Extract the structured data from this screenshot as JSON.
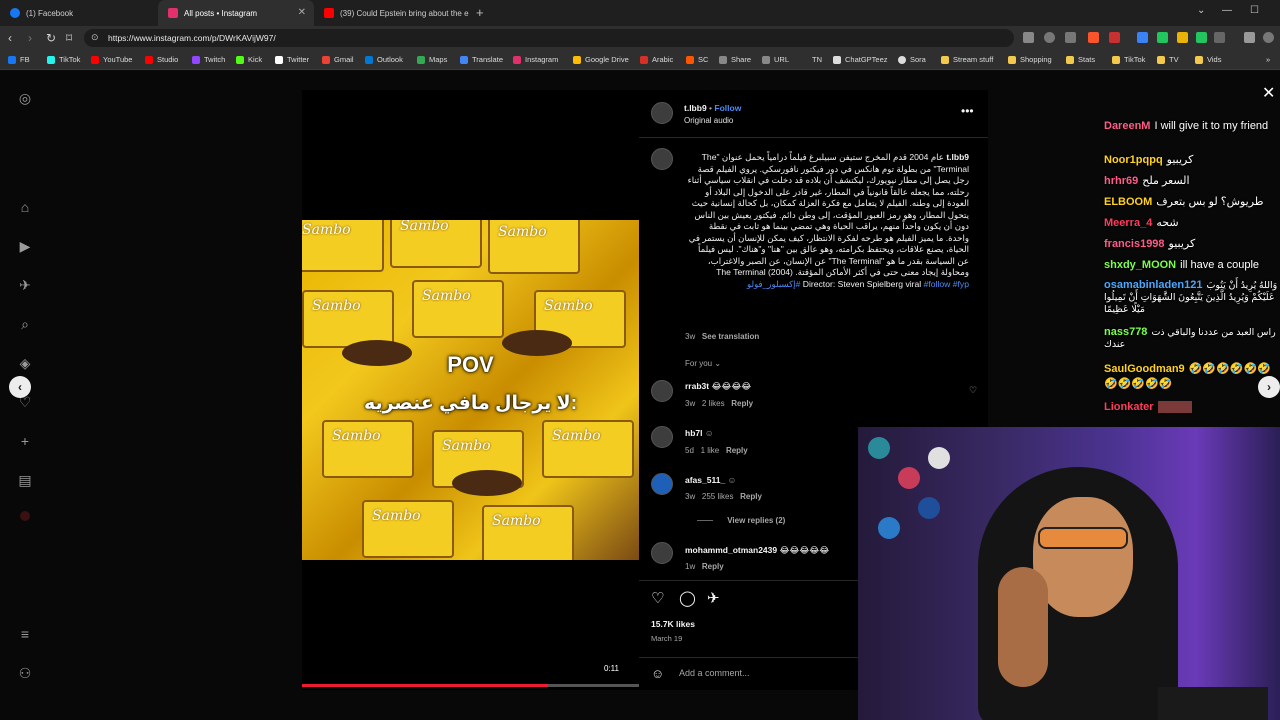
{
  "browser": {
    "tabs": [
      {
        "label": "(1) Facebook",
        "color": "#1877f2",
        "active": false
      },
      {
        "label": "All posts • Instagram",
        "color": "#e1306c",
        "active": true
      },
      {
        "label": "(39) Could Epstein bring about the e",
        "color": "#ff0000",
        "active": false
      }
    ],
    "url": "https://www.instagram.com/p/DWrKAVijW97/",
    "bookmarks": [
      {
        "label": "FB",
        "color": "#1877f2"
      },
      {
        "label": "TikTok",
        "color": "#25f4ee"
      },
      {
        "label": "YouTube",
        "color": "#ff0000"
      },
      {
        "label": "Studio",
        "color": "#ff0000"
      },
      {
        "label": "Twitch",
        "color": "#9146ff"
      },
      {
        "label": "Kick",
        "color": "#53fc18"
      },
      {
        "label": "Twitter",
        "color": "#ffffff"
      },
      {
        "label": "Gmail",
        "color": "#ea4335"
      },
      {
        "label": "Outlook",
        "color": "#0078d4"
      },
      {
        "label": "Maps",
        "color": "#34a853"
      },
      {
        "label": "Translate",
        "color": "#4285f4"
      },
      {
        "label": "Instagram",
        "color": "#e1306c"
      },
      {
        "label": "Google Drive",
        "color": "#fbbc04"
      },
      {
        "label": "Arabic",
        "color": "#d93025"
      },
      {
        "label": "SC",
        "color": "#ff5500"
      },
      {
        "label": "Share",
        "color": "#888888"
      },
      {
        "label": "URL",
        "color": "#888888"
      },
      {
        "label": "TN",
        "color": "#888888"
      },
      {
        "label": "ChatGPTeez",
        "color": "#dddddd"
      },
      {
        "label": "Sora",
        "color": "#dddddd"
      },
      {
        "label": "Stream stuff",
        "color": "#f2c94c"
      },
      {
        "label": "Shopping",
        "color": "#f2c94c"
      },
      {
        "label": "Stats",
        "color": "#f2c94c"
      },
      {
        "label": "TikTok",
        "color": "#f2c94c"
      },
      {
        "label": "TV",
        "color": "#f2c94c"
      },
      {
        "label": "Vids",
        "color": "#f2c94c"
      }
    ]
  },
  "post": {
    "username": "t.lbb9",
    "follow_label": "Follow",
    "separator": "•",
    "audio": "Original audio",
    "more_icon": "more-horizontal-icon",
    "caption_user": "t.lbb9",
    "caption": "عام 2004 قدم المخرج ستيفن سبيلبرغ فيلماً درامياً يحمل عنوان \"The Terminal\" من بطولة توم هانكس في دور فيكتور نافورسكي. يروي الفيلم قصة رجل يصل إلى مطار نيويورك، ليكتشف أن بلاده قد دخلت في انقلاب سياسي أثناء رحلته، مما يجعله عالقاً قانونياً في المطار، غير قادر على الدخول إلى البلاد أو العودة إلى وطنه. الفيلم لا يتعامل مع فكرة العزلة كمكان، بل كحالة إنسانية حيث يتحول المطار، وهو رمز العبور المؤقت، إلى وطن دائم. فيكتور يعيش بين الناس دون أن يكون واحداً منهم، يراقب الحياة وهي تمضي بينما هو ثابت في نقطة واحدة. ما يميز الفيلم هو طرحه لفكرة الانتظار، كيف يمكن للإنسان أن يستمر في الحياة، يصنع علاقات، ويحتفظ بكرامته، وهو عالق بين \"هنا\" و\"هناك\". ليس فيلماً عن السياسة بقدر ما هو \"The Terminal\" عن الإنسان، عن الصبر والاغتراب، ومحاولة إيجاد معنى حتى في أكثر الأماكن المؤقتة. The Terminal (2004) Director: Steven Spielberg viral",
    "hashtags": "#follow #fyp #إكسبلور_فولو",
    "caption_age": "3w",
    "see_translation": "See translation",
    "for_you": "For you ⌄",
    "comments": [
      {
        "user": "rrab3t",
        "text": "😂😂😂😂",
        "age": "3w",
        "likes": "2 likes",
        "reply": "Reply"
      },
      {
        "user": "hb7l",
        "text": "☺",
        "age": "5d",
        "likes": "1 like",
        "reply": "Reply"
      },
      {
        "user": "afas_511_",
        "text": "☺",
        "age": "3w",
        "likes": "255 likes",
        "reply": "Reply",
        "view_replies": "View replies (2)"
      },
      {
        "user": "mohammd_otman2439",
        "text": "😂😂😂😂😂",
        "age": "1w",
        "likes": "",
        "reply": "Reply"
      }
    ],
    "likes_count": "15.7K likes",
    "date": "March 19",
    "add_comment_placeholder": "Add a comment...",
    "video_time": "0:11",
    "video_progress": 0.73,
    "video_overlay": {
      "pov": "POV",
      "caption": "لا يرجال مافي عنصريه:"
    }
  },
  "chat": [
    {
      "name": "DareenM",
      "color": "#ff5c8a",
      "text": "I will give it to my friend"
    },
    {
      "name": "Noor1pqpq",
      "color": "#ffd21f",
      "text": "كريبيو"
    },
    {
      "name": "hrhr69",
      "color": "#ff5c8a",
      "text": "السعر ملح"
    },
    {
      "name": "ELBOOM",
      "color": "#ffd21f",
      "text": "طريوش؟ لو بس بتعرف"
    },
    {
      "name": "Meerra_4",
      "color": "#ff3c5c",
      "text": "شحه"
    },
    {
      "name": "francis1998",
      "color": "#ff5c8a",
      "text": "كريبيو"
    },
    {
      "name": "shxdy_MOON",
      "color": "#7cff4c",
      "text": "ill have a couple"
    },
    {
      "name": "osamabinladen121",
      "color": "#4ca8ff",
      "text": "وَاللهُ يُرِيدُ أَنْ يَتُوبَ عَلَيْكُمْ وَيُرِيدُ الَّذِينَ يَتَّبِعُونَ الشَّهَوَاتِ أَنْ تَمِيلُوا مَيْلًا عَظِيمًا"
    },
    {
      "name": "nass778",
      "color": "#7cff4c",
      "text": "راس العبد من عددنا والباقي ذت عندك"
    },
    {
      "name": "SaulGoodman9",
      "color": "#ffd21f",
      "text": "🤣🤣🤣🤣🤣🤣🤣🤣🤣🤣🤣"
    },
    {
      "name": "Lionkater",
      "color": "#ff3c5c",
      "text": ""
    }
  ]
}
